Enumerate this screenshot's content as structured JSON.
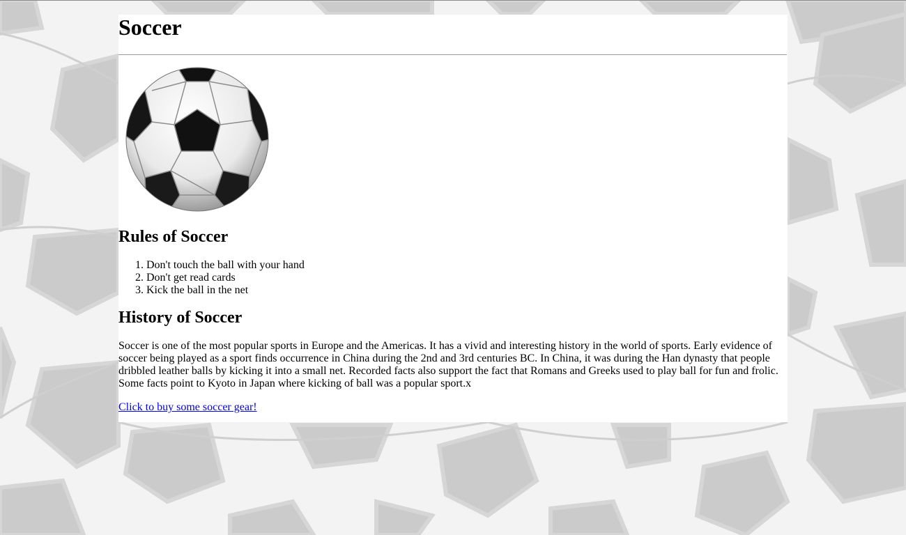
{
  "page": {
    "title": "Soccer"
  },
  "rules": {
    "heading": "Rules of Soccer",
    "items": [
      "Don't touch the ball with your hand",
      "Don't get read cards",
      "Kick the ball in the net"
    ]
  },
  "history": {
    "heading": "History of Soccer",
    "text": "Soccer is one of the most popular sports in Europe and the Americas. It has a vivid and interesting history in the world of sports. Early evidence of soccer being played as a sport finds occurrence in China during the 2nd and 3rd centuries BC. In China, it was during the Han dynasty that people dribbled leather balls by kicking it into a small net. Recorded facts also support the fact that Romans and Greeks used to play ball for fun and frolic. Some facts point to Kyoto in Japan where kicking of ball was a popular sport.x"
  },
  "gear_link": {
    "label": "Click to buy some soccer gear!"
  },
  "images": {
    "hero": "soccer-ball-image",
    "background": "soccer-ball-pattern"
  },
  "colors": {
    "background_panels": "#cbcbcb",
    "background_light": "#f4f4f4",
    "content_bg": "#ffffff",
    "link": "#0000ee"
  }
}
